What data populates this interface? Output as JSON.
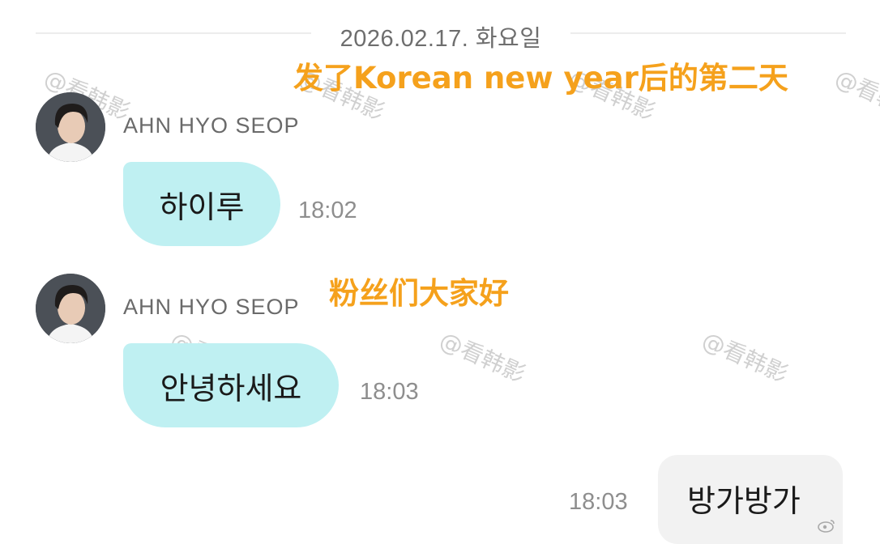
{
  "date_divider": "2026.02.17. 화요일",
  "captions": [
    "发了Korean new year后的第二天",
    "粉丝们大家好"
  ],
  "watermark": "@看韩影",
  "messages": [
    {
      "sender": "AHN HYO SEOP",
      "text": "하이루",
      "time": "18:02",
      "direction": "incoming"
    },
    {
      "sender": "AHN HYO SEOP",
      "text": "안녕하세요",
      "time": "18:03",
      "direction": "incoming"
    },
    {
      "text": "방가방가",
      "time": "18:03",
      "direction": "outgoing"
    }
  ],
  "colors": {
    "incoming_bubble": "#bff0f2",
    "outgoing_bubble": "#f2f2f2",
    "caption": "#f5a11c"
  },
  "icons": [
    "avatar",
    "weibo-logo-icon"
  ]
}
